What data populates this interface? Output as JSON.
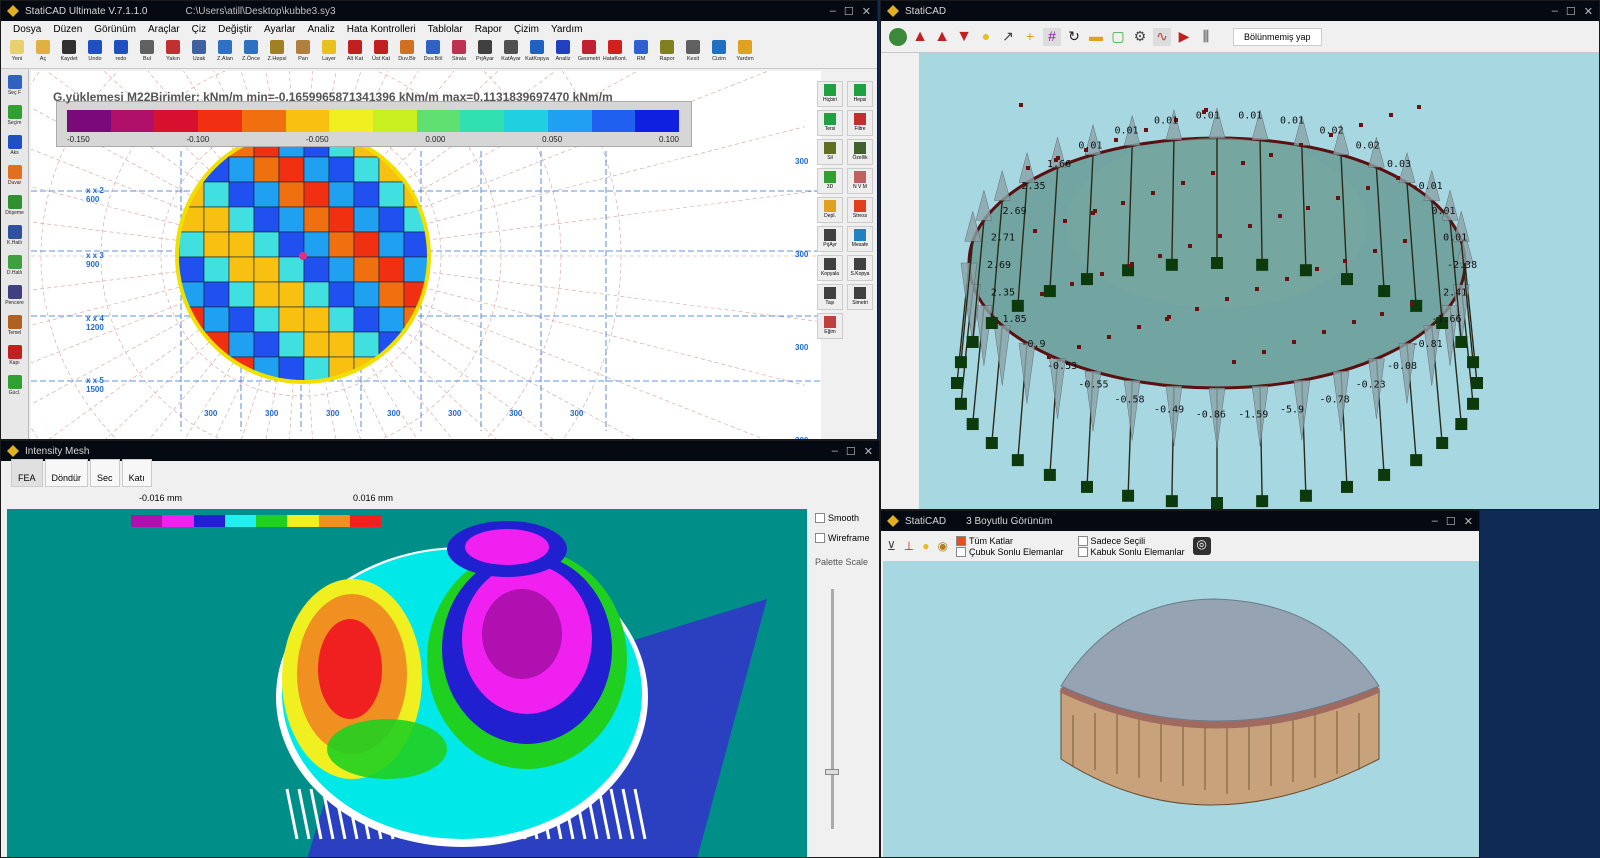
{
  "main": {
    "title": "StatiCAD Ultimate V.7.1.1.0",
    "path": "C:\\Users\\atill\\Desktop\\kubbe3.sy3",
    "menu": [
      "Dosya",
      "Düzen",
      "Görünüm",
      "Araçlar",
      "Çiz",
      "Değiştir",
      "Ayarlar",
      "Analiz",
      "Hata Kontrolleri",
      "Tablolar",
      "Rapor",
      "Çizim",
      "Yardım"
    ],
    "toolbar": [
      {
        "label": "Yeni",
        "color": "#e8d070"
      },
      {
        "label": "Aç",
        "color": "#e0b040"
      },
      {
        "label": "Kaydet",
        "color": "#303030"
      },
      {
        "label": "Undo",
        "color": "#2050c0"
      },
      {
        "label": "redo",
        "color": "#2050c0"
      },
      {
        "label": "Bul",
        "color": "#606060"
      },
      {
        "label": "Yakın",
        "color": "#c03030"
      },
      {
        "label": "Uzak",
        "color": "#4060a0"
      },
      {
        "label": "Z.Alan",
        "color": "#3070c0"
      },
      {
        "label": "Z.Önce",
        "color": "#3070c0"
      },
      {
        "label": "Z.Hepsi",
        "color": "#a08020"
      },
      {
        "label": "Pan",
        "color": "#b08040"
      },
      {
        "label": "Layer",
        "color": "#e8c020"
      },
      {
        "label": "Alt Kat",
        "color": "#c02020"
      },
      {
        "label": "Üst Kat",
        "color": "#c02020"
      },
      {
        "label": "Duv.Bir",
        "color": "#d07020"
      },
      {
        "label": "Duv.Böl",
        "color": "#3060c0"
      },
      {
        "label": "Sirala",
        "color": "#c03050"
      },
      {
        "label": "PrjAyar",
        "color": "#404040"
      },
      {
        "label": "KatAyar",
        "color": "#505050"
      },
      {
        "label": "KatKopya",
        "color": "#2060c0"
      },
      {
        "label": "Analiz",
        "color": "#2040c0"
      },
      {
        "label": "Geometri",
        "color": "#c02030"
      },
      {
        "label": "HataKont.",
        "color": "#d02020"
      },
      {
        "label": "RM",
        "color": "#3060d0"
      },
      {
        "label": "Rapor",
        "color": "#808020"
      },
      {
        "label": "Kesit",
        "color": "#606060"
      },
      {
        "label": "Cizim",
        "color": "#2070c0"
      },
      {
        "label": "Yardım",
        "color": "#e0a020"
      }
    ],
    "sidebar": [
      {
        "label": "Seç F",
        "color": "#3060c0"
      },
      {
        "label": "Seçim",
        "color": "#30a030"
      },
      {
        "label": "Aks",
        "color": "#2050c0"
      },
      {
        "label": "Duvar",
        "color": "#e07020"
      },
      {
        "label": "Döşeme",
        "color": "#309030"
      },
      {
        "label": "K.Hatlı",
        "color": "#3050a0"
      },
      {
        "label": "D.Hatlı",
        "color": "#40a040"
      },
      {
        "label": "Pencere",
        "color": "#404080"
      },
      {
        "label": "Temel",
        "color": "#b06020"
      },
      {
        "label": "Kapı",
        "color": "#c02020"
      },
      {
        "label": "Gücl.",
        "color": "#30a030"
      }
    ],
    "rsidebar": [
      {
        "label": "Hiçbiri",
        "color": "#20a040"
      },
      {
        "label": "Hepsi",
        "color": "#20a040"
      },
      {
        "label": "Tersi",
        "color": "#20a040"
      },
      {
        "label": "Filtre",
        "color": "#c03030"
      },
      {
        "label": "Sil",
        "color": "#607020"
      },
      {
        "label": "Özellik",
        "color": "#406030"
      },
      {
        "label": "3D",
        "color": "#30a030"
      },
      {
        "label": "N V M",
        "color": "#c06060"
      },
      {
        "label": "Depl.",
        "color": "#e0a020"
      },
      {
        "label": "Stress",
        "color": "#e04020"
      },
      {
        "label": "PrjAyr",
        "color": "#404040"
      },
      {
        "label": "Mesafe",
        "color": "#2080c0"
      },
      {
        "label": "Kopyala",
        "color": "#404040"
      },
      {
        "label": "S.Kopya",
        "color": "#404040"
      },
      {
        "label": "Taşı",
        "color": "#404040"
      },
      {
        "label": "Simetri",
        "color": "#404040"
      },
      {
        "label": "Eğim",
        "color": "#c04040"
      }
    ],
    "legend_title": "G.yüklemesi M22Birimler: kNm/m min=-0.1659965871341396 kNm/m max=0.1131839697470 kNm/m",
    "legend_ticks": [
      "-0.150",
      "-0.100",
      "-0.050",
      "0.000",
      "0.050",
      "0.100"
    ],
    "legend_colors": [
      "#7a0a7a",
      "#b0106a",
      "#d81030",
      "#f03010",
      "#f07010",
      "#f8c010",
      "#f0f020",
      "#c8f020",
      "#60e070",
      "#30e0b0",
      "#20d0e0",
      "#20a0f0",
      "#2060f0",
      "#1020e0"
    ],
    "axis_labels": [
      {
        "name": "x x 2",
        "val": "600"
      },
      {
        "name": "x x 3",
        "val": "900"
      },
      {
        "name": "x x 4",
        "val": "1200"
      },
      {
        "name": "x x 5",
        "val": "1500"
      }
    ],
    "bottom_dims": [
      "300",
      "300",
      "300",
      "300",
      "300",
      "300",
      "300"
    ],
    "right_dims": [
      "300",
      "300",
      "300",
      "300"
    ]
  },
  "top_right": {
    "title": "StatiCAD",
    "button": "Bölünmemiş yap",
    "labels": [
      "-2.38",
      "2.41",
      "-1.66",
      "-0.81",
      "-0.08",
      "-0.23",
      "-0.78",
      "-5.9",
      "-1.59",
      "-0.86",
      "-0.49",
      "-0.58",
      "-0.55",
      "-0.53",
      "-0.9",
      "1.85",
      "2.35",
      "2.69",
      "2.71",
      "2.69",
      "2.35",
      "1.66",
      "0.01",
      "0.01",
      "0.01",
      "0.01",
      "0.01",
      "0.01",
      "0.02",
      "0.02",
      "0.03",
      "-0.01",
      "0.01",
      "0.01"
    ]
  },
  "mesh": {
    "title": "Intensity Mesh",
    "tabs": [
      "FEA",
      "Döndür",
      "Sec",
      "Katı"
    ],
    "min": "-0.016 mm",
    "max": "0.016 mm",
    "palette": [
      "#b010b0",
      "#f020f0",
      "#2020d0",
      "#20f0f0",
      "#20d020",
      "#f0f020",
      "#f09020",
      "#f02020"
    ],
    "smooth": "Smooth",
    "wireframe": "Wireframe",
    "palette_scale": "Palette Scale"
  },
  "view3d": {
    "title": "StatiCAD",
    "subtitle": "3 Boyutlu Görünüm",
    "options": [
      {
        "label": "Tüm Katlar",
        "checked": true
      },
      {
        "label": "Sadece Seçili",
        "checked": false
      },
      {
        "label": "Çubuk Sonlu Elemanlar",
        "checked": false
      },
      {
        "label": "Kabuk Sonlu Elemanlar",
        "checked": false
      }
    ]
  }
}
